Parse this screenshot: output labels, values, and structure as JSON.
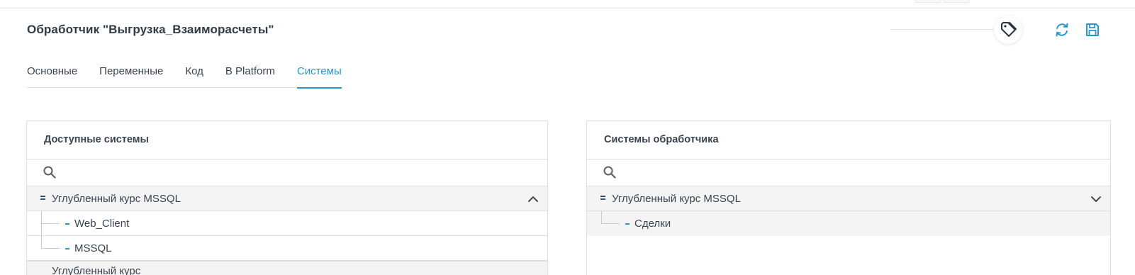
{
  "header": {
    "title": "Обработчик \"Выгрузка_Взаиморасчеты\""
  },
  "toolbar": {
    "tag_icon": "tag-icon",
    "refresh_icon": "refresh-icon",
    "save_icon": "save-icon",
    "accent_color": "#2a97c8"
  },
  "tabs": [
    {
      "label": "Основные",
      "active": false
    },
    {
      "label": "Переменные",
      "active": false
    },
    {
      "label": "Код",
      "active": false
    },
    {
      "label": "В Platform",
      "active": false
    },
    {
      "label": "Системы",
      "active": true
    }
  ],
  "available": {
    "title": "Доступные системы",
    "search_placeholder": "",
    "groups": [
      {
        "label": "Углубленный курс MSSQL",
        "expanded": true,
        "items": [
          "Web_Client",
          "MSSQL"
        ]
      },
      {
        "label": "Углубленный курс",
        "expanded": false,
        "items": []
      }
    ]
  },
  "handler": {
    "title": "Системы обработчика",
    "search_placeholder": "",
    "groups": [
      {
        "label": "Углубленный курс MSSQL",
        "expanded": true,
        "items": [
          "Сделки"
        ]
      }
    ]
  }
}
